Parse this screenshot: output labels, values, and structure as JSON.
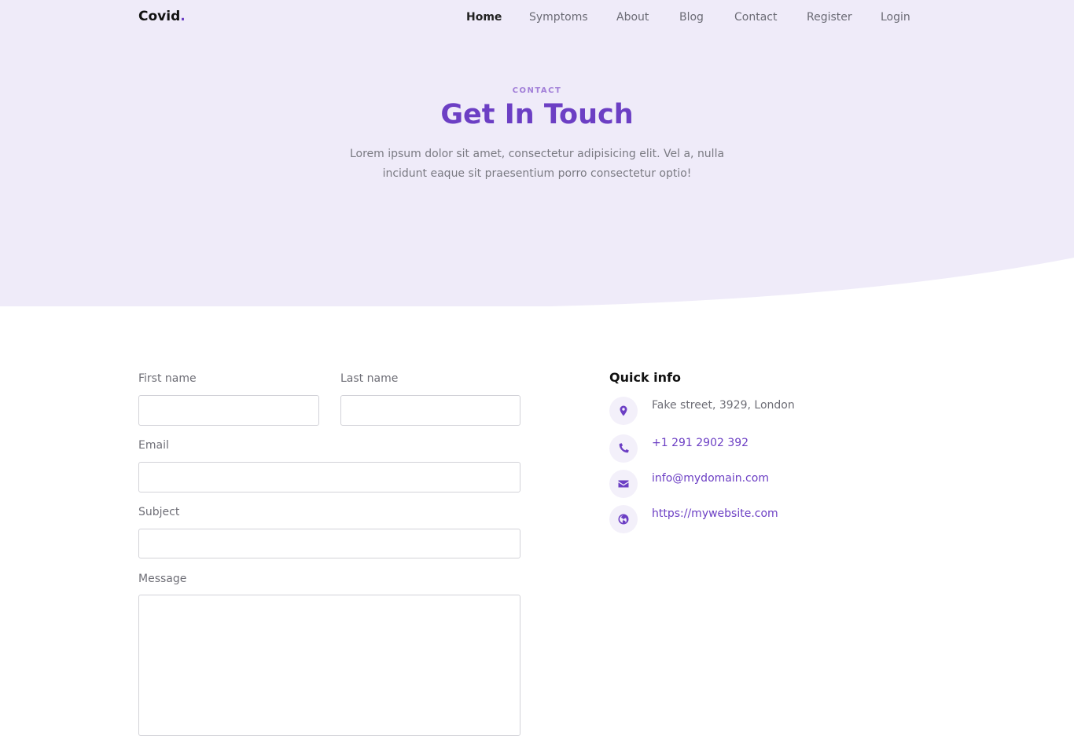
{
  "brand": {
    "name": "Covid",
    "dot": "."
  },
  "nav": {
    "items": [
      {
        "label": "Home",
        "active": true
      },
      {
        "label": "Symptoms"
      },
      {
        "label": "About"
      },
      {
        "label": "Blog"
      },
      {
        "label": "Contact"
      },
      {
        "label": "Register"
      },
      {
        "label": "Login"
      }
    ]
  },
  "hero": {
    "eyebrow": "CONTACT",
    "title": "Get In Touch",
    "lead": "Lorem ipsum dolor sit amet, consectetur adipisicing elit. Vel a, nulla incidunt eaque sit praesentium porro consectetur optio!"
  },
  "form": {
    "first_name_label": "First name",
    "last_name_label": "Last name",
    "email_label": "Email",
    "subject_label": "Subject",
    "message_label": "Message",
    "first_name_value": "",
    "last_name_value": "",
    "email_value": "",
    "subject_value": "",
    "message_value": ""
  },
  "quick_info": {
    "title": "Quick info",
    "address": {
      "icon": "map-pin-icon",
      "text": "Fake street, 3929, London"
    },
    "phone": {
      "icon": "phone-icon",
      "text": "+1 291 2902 392"
    },
    "email": {
      "icon": "envelope-icon",
      "text": "info@mydomain.com"
    },
    "website": {
      "icon": "globe-icon",
      "text": "https://mywebsite.com"
    }
  },
  "colors": {
    "accent": "#6c3fc4",
    "hero_bg": "#efebf9",
    "eyebrow": "#a27fd8"
  }
}
